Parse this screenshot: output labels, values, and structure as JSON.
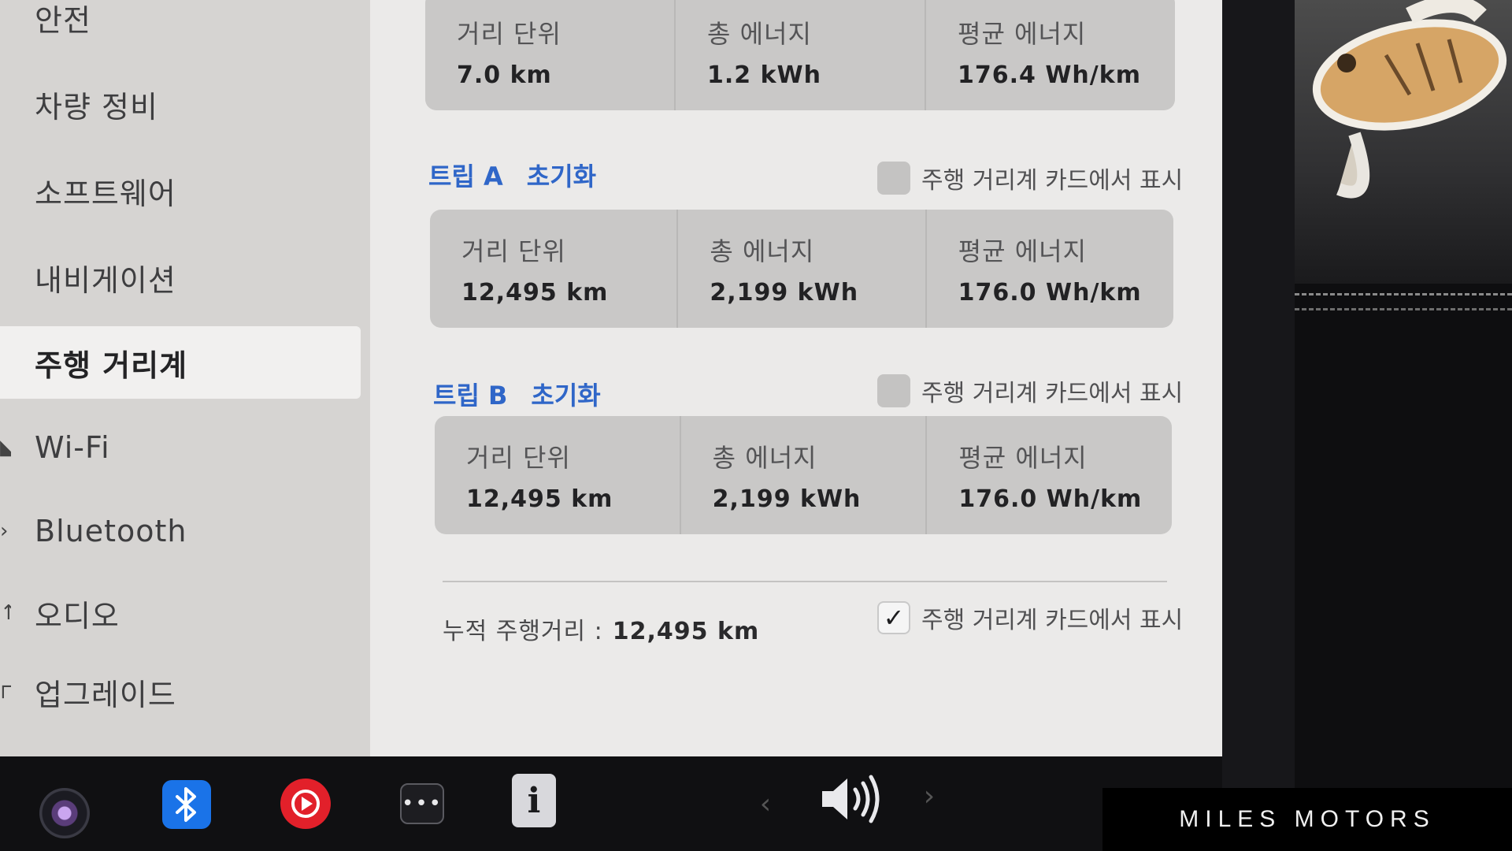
{
  "sidebar": {
    "items": [
      {
        "label": "안전"
      },
      {
        "label": "차량 정비"
      },
      {
        "label": "소프트웨어"
      },
      {
        "label": "내비게이션"
      },
      {
        "label": "주행 거리계"
      },
      {
        "label": "Wi-Fi"
      },
      {
        "label": "Bluetooth"
      },
      {
        "label": "오디오"
      },
      {
        "label": "업그레이드"
      }
    ],
    "active": "주행 거리계"
  },
  "recent": {
    "distance_label": "거리 단위",
    "distance_value": "7.0 km",
    "energy_label": "총 에너지",
    "energy_value": "1.2 kWh",
    "avg_label": "평균 에너지",
    "avg_value": "176.4 Wh/km"
  },
  "trip_a": {
    "title": "트립 A",
    "reset_label": "초기화",
    "show_label": "주행 거리계 카드에서 표시",
    "show_checked": false,
    "distance_label": "거리 단위",
    "distance_value": "12,495 km",
    "energy_label": "총 에너지",
    "energy_value": "2,199 kWh",
    "avg_label": "평균 에너지",
    "avg_value": "176.0 Wh/km"
  },
  "trip_b": {
    "title": "트립 B",
    "reset_label": "초기화",
    "show_label": "주행 거리계 카드에서 표시",
    "show_checked": false,
    "distance_label": "거리 단위",
    "distance_value": "12,495 km",
    "energy_label": "총 에너지",
    "energy_value": "2,199 kWh",
    "avg_label": "평균 에너지",
    "avg_value": "176.0 Wh/km"
  },
  "odometer": {
    "label": "누적 주행거리 :",
    "value": "12,495 km",
    "show_label": "주행 거리계 카드에서 표시",
    "show_checked": true,
    "check_glyph": "✓"
  },
  "taskbar": {
    "icons": [
      "camera-icon",
      "bluetooth-icon",
      "youtube-icon",
      "more-icon",
      "manual-icon",
      "volume-icon"
    ],
    "manual_glyph": "i",
    "more_glyph": "•••",
    "prev_glyph": "‹",
    "next_glyph": "›"
  },
  "watermark": {
    "text": "MILES MOTORS"
  },
  "colors": {
    "accent": "#2f66c8",
    "screen_bg": "#ebeae9",
    "card_bg": "#c9c8c7",
    "bluetooth": "#1a73e8",
    "youtube": "#e2202a"
  }
}
